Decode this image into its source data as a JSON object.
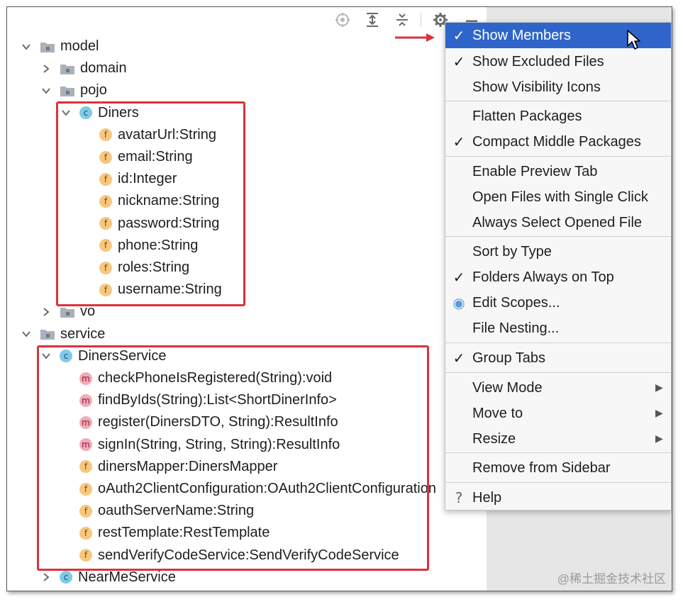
{
  "tree": {
    "rows": [
      {
        "label": "model",
        "type": "folder",
        "expanded": true
      },
      {
        "label": "domain",
        "type": "folder",
        "expanded": false
      },
      {
        "label": "pojo",
        "type": "folder",
        "expanded": true
      },
      {
        "label": "Diners",
        "type": "class",
        "badge": "c",
        "expanded": true
      },
      {
        "label": "avatarUrl:String",
        "type": "field",
        "badge": "f"
      },
      {
        "label": "email:String",
        "type": "field",
        "badge": "f"
      },
      {
        "label": "id:Integer",
        "type": "field",
        "badge": "f"
      },
      {
        "label": "nickname:String",
        "type": "field",
        "badge": "f"
      },
      {
        "label": "password:String",
        "type": "field",
        "badge": "f"
      },
      {
        "label": "phone:String",
        "type": "field",
        "badge": "f"
      },
      {
        "label": "roles:String",
        "type": "field",
        "badge": "f"
      },
      {
        "label": "username:String",
        "type": "field",
        "badge": "f"
      },
      {
        "label": "vo",
        "type": "folder",
        "expanded": false
      },
      {
        "label": "service",
        "type": "folder",
        "expanded": true
      },
      {
        "label": "DinersService",
        "type": "class",
        "badge": "c",
        "expanded": true
      },
      {
        "label": "checkPhoneIsRegistered(String):void",
        "type": "method",
        "badge": "m"
      },
      {
        "label": "findByIds(String):List<ShortDinerInfo>",
        "type": "method",
        "badge": "m"
      },
      {
        "label": "register(DinersDTO, String):ResultInfo",
        "type": "method",
        "badge": "m"
      },
      {
        "label": "signIn(String, String, String):ResultInfo",
        "type": "method",
        "badge": "m"
      },
      {
        "label": "dinersMapper:DinersMapper",
        "type": "field",
        "badge": "f"
      },
      {
        "label": "oAuth2ClientConfiguration:OAuth2ClientConfiguration",
        "type": "field",
        "badge": "f"
      },
      {
        "label": "oauthServerName:String",
        "type": "field",
        "badge": "f"
      },
      {
        "label": "restTemplate:RestTemplate",
        "type": "field",
        "badge": "f"
      },
      {
        "label": "sendVerifyCodeService:SendVerifyCodeService",
        "type": "field",
        "badge": "f"
      },
      {
        "label": "NearMeService",
        "type": "class",
        "badge": "c",
        "expanded": false
      }
    ]
  },
  "menu": {
    "items": [
      {
        "label": "Show Members",
        "mark": "✓",
        "selected": true
      },
      {
        "label": "Show Excluded Files",
        "mark": "✓"
      },
      {
        "label": "Show Visibility Icons",
        "mark": ""
      },
      {
        "label": "Flatten Packages",
        "mark": ""
      },
      {
        "label": "Compact Middle Packages",
        "mark": "✓"
      },
      {
        "label": "Enable Preview Tab",
        "mark": ""
      },
      {
        "label": "Open Files with Single Click",
        "mark": ""
      },
      {
        "label": "Always Select Opened File",
        "mark": ""
      },
      {
        "label": "Sort by Type",
        "mark": ""
      },
      {
        "label": "Folders Always on Top",
        "mark": "✓"
      },
      {
        "label": "Edit Scopes...",
        "mark": "◉"
      },
      {
        "label": "File Nesting...",
        "mark": ""
      },
      {
        "label": "Group Tabs",
        "mark": "✓"
      },
      {
        "label": "View Mode",
        "mark": "",
        "submenu": "▶"
      },
      {
        "label": "Move to",
        "mark": "",
        "submenu": "▶"
      },
      {
        "label": "Resize",
        "mark": "",
        "submenu": "▶"
      },
      {
        "label": "Remove from Sidebar",
        "mark": ""
      },
      {
        "label": "Help",
        "mark": "?"
      }
    ]
  },
  "toolbar": {
    "icons": [
      "locate-icon",
      "expand-all-icon",
      "collapse-all-icon",
      "gear-icon",
      "minimize-icon"
    ]
  },
  "watermark": "@稀土掘金技术社区",
  "colors": {
    "selection": "#2f65ca",
    "highlight_box": "#d9333e",
    "arrow": "#d9333e"
  }
}
